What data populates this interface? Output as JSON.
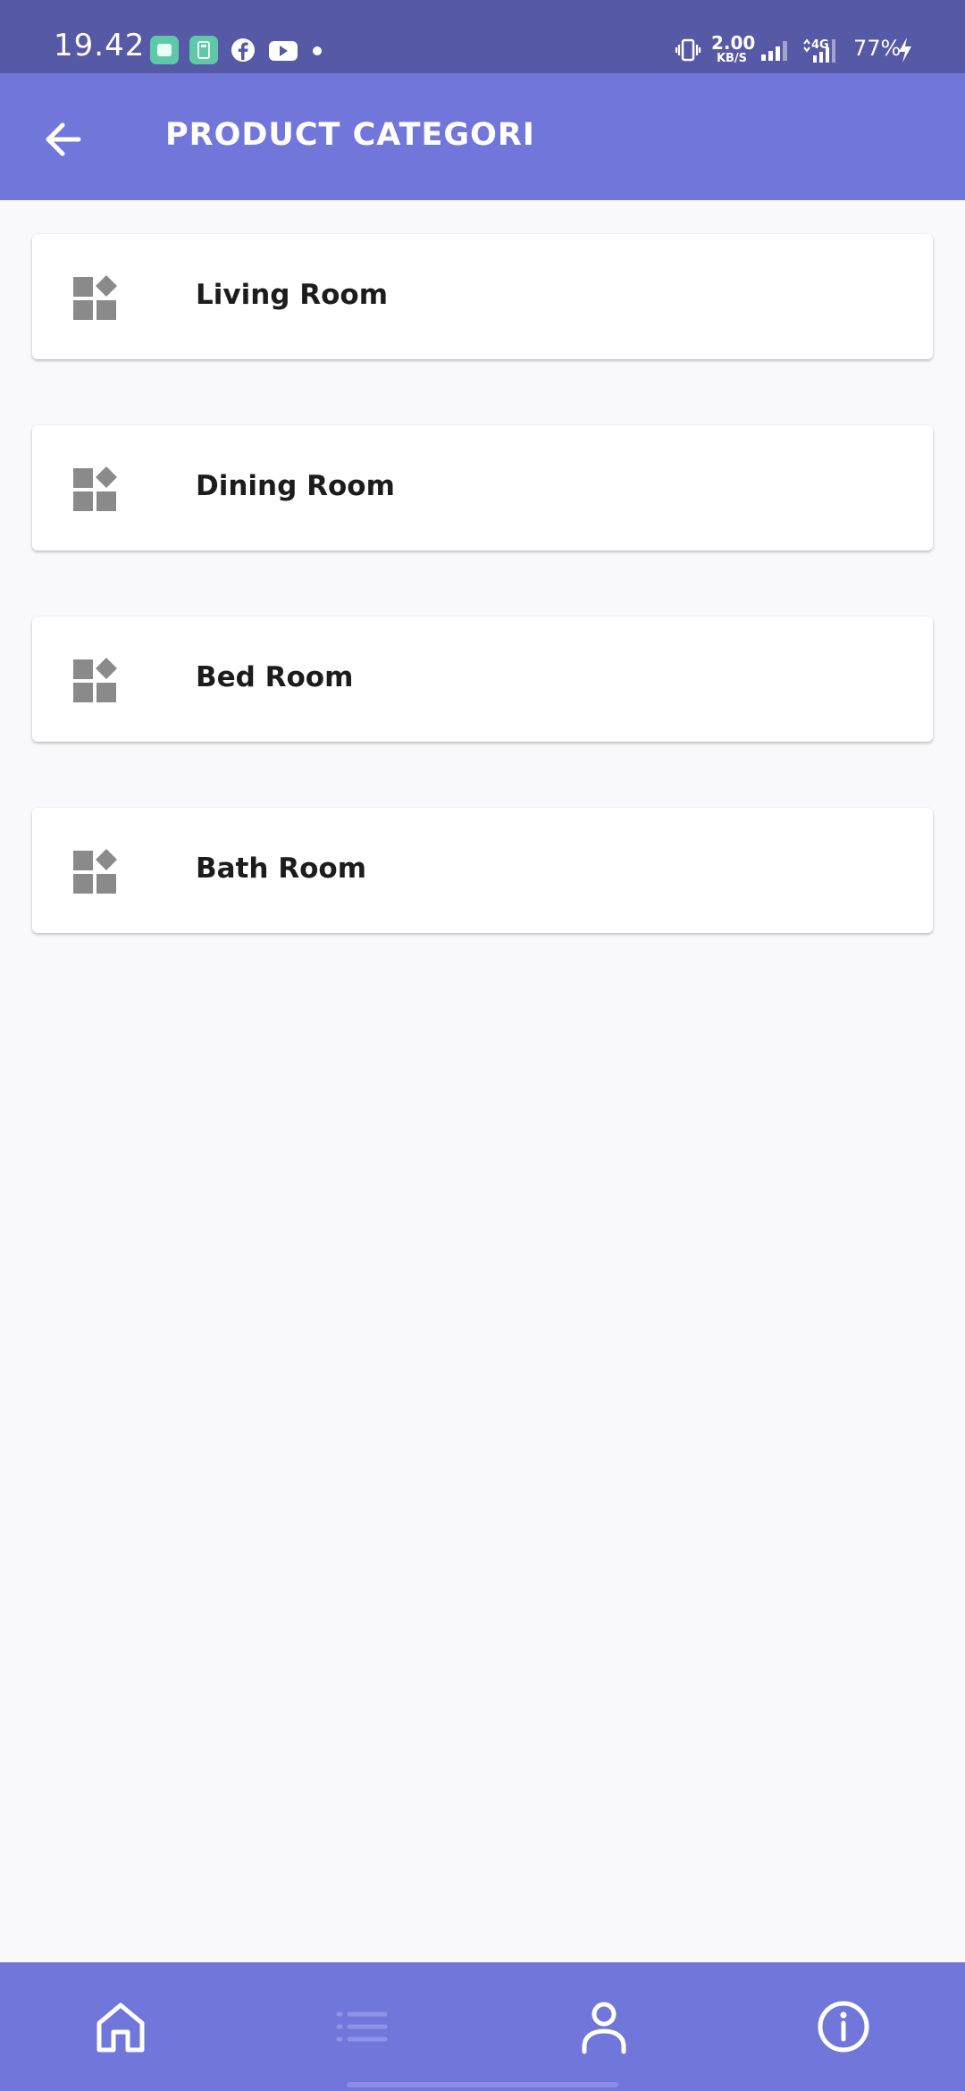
{
  "status_bar": {
    "time": "19.42",
    "net_speed_value": "2.00",
    "net_speed_unit": "KB/S",
    "network_type": "4G",
    "battery": "77%",
    "notification_icons": [
      "message-app-icon",
      "calculator-app-icon",
      "facebook-icon",
      "youtube-icon",
      "more-dot-icon"
    ]
  },
  "app_bar": {
    "title": "PRODUCT CATEGORI",
    "back_icon": "arrow-left-icon"
  },
  "categories": [
    {
      "label": "Living Room",
      "icon": "widgets-icon"
    },
    {
      "label": "Dining Room",
      "icon": "widgets-icon"
    },
    {
      "label": "Bed Room",
      "icon": "widgets-icon"
    },
    {
      "label": "Bath Room",
      "icon": "widgets-icon"
    }
  ],
  "bottom_nav": {
    "items": [
      {
        "name": "home",
        "icon": "home-icon",
        "active": false
      },
      {
        "name": "categories",
        "icon": "list-icon",
        "active": true
      },
      {
        "name": "profile",
        "icon": "person-icon",
        "active": false
      },
      {
        "name": "info",
        "icon": "info-icon",
        "active": false
      }
    ]
  },
  "colors": {
    "status_bar": "#5659a5",
    "primary": "#7176db",
    "background": "#f9f9fb",
    "card": "#ffffff",
    "icon_gray": "#8a8a8a",
    "nav_active": "#8f93e8"
  }
}
